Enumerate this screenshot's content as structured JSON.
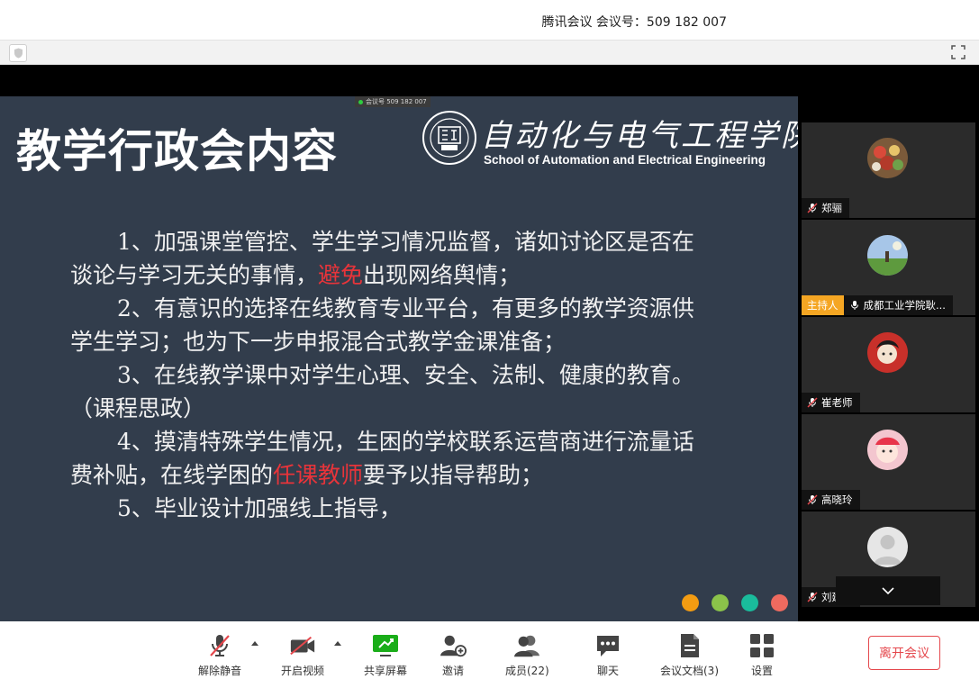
{
  "window": {
    "title": "腾讯会议 会议号：509 182 007"
  },
  "share": {
    "meeting_tag": "会议号 509 182 007"
  },
  "slide": {
    "title": "教学行政会内容",
    "school_cn": "自动化与电气工程学院",
    "school_en": "School of Automation and Electrical Engineering",
    "items": [
      {
        "lead": "1、加强课堂管控、学生学习情况监督，诸如讨论区是否在",
        "tail": "谈论与学习无关的事情，",
        "red": "避免",
        "after": "出现网络舆情；"
      },
      {
        "lead": "2、有意识的选择在线教育专业平台，有更多的教学资源供",
        "tail": "学生学习；也为下一步申报混合式教学金课准备；",
        "red": "",
        "after": ""
      },
      {
        "lead": "3、在线教学课中对学生心理、安全、法制、健康的教育。",
        "tail": "（课程思政）",
        "red": "",
        "after": ""
      },
      {
        "lead": "4、摸清特殊学生情况，生困的学校联系运营商进行流量话",
        "tail": "费补贴，在线学困的",
        "red": "任课教师",
        "after": "要予以指导帮助；"
      },
      {
        "lead": "5、毕业设计加强线上指导，",
        "tail": "",
        "red": "",
        "after": ""
      }
    ],
    "dot_colors": [
      "#f39c12",
      "#8bc34a",
      "#1abc9c",
      "#ee6a5f"
    ]
  },
  "participants": [
    {
      "name": "郑骊",
      "host": false
    },
    {
      "name": "成都工业学院耿...",
      "host": true,
      "host_label": "主持人"
    },
    {
      "name": "崔老师",
      "host": false
    },
    {
      "name": "高晓玲",
      "host": false
    },
    {
      "name": "刘建华",
      "host": false
    }
  ],
  "toolbar": {
    "mute": "解除静音",
    "video": "开启视频",
    "share": "共享屏幕",
    "invite": "邀请",
    "members": "成员(22)",
    "chat": "聊天",
    "docs": "会议文档(3)",
    "settings": "设置",
    "leave": "离开会议"
  },
  "colors": {
    "accent_green": "#1aad19",
    "leave_red": "#e5484d",
    "host_badge": "#f5a623",
    "slide_bg": "#323d4c"
  }
}
